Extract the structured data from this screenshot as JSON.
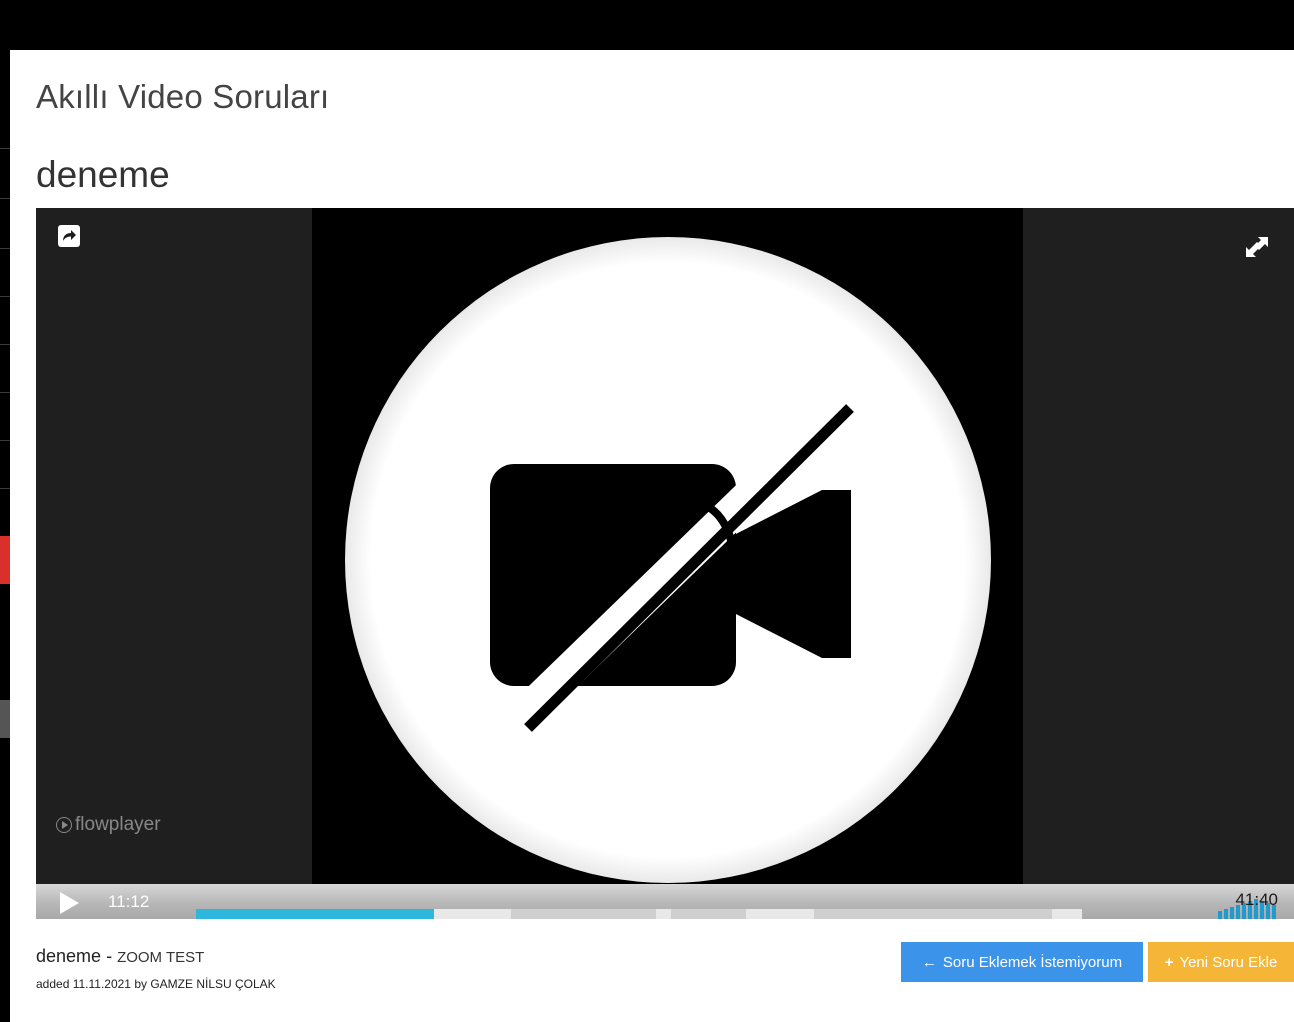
{
  "header": {
    "app_title": "Akıllı Video Soruları"
  },
  "video": {
    "title": "deneme",
    "time_elapsed": "11:12",
    "time_total": "41:40",
    "progress_fraction": 0.269,
    "watermark": "flowplayer"
  },
  "meta": {
    "name": "deneme",
    "separator": " - ",
    "subtitle": "ZOOM TEST",
    "added": "added 11.11.2021 by GAMZE NİLSU ÇOLAK"
  },
  "actions": {
    "skip_label": "Soru Eklemek İstemiyorum",
    "skip_icon": "arrow-left-icon",
    "add_label": "Yeni Soru Ekle",
    "add_icon": "plus-icon"
  },
  "colors": {
    "progress": "#2fb6dd",
    "skip_button": "#3c93ea",
    "add_button": "#f5b536"
  }
}
